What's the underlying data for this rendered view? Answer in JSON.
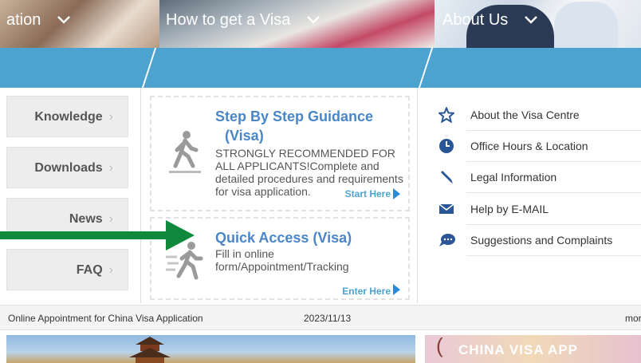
{
  "nav": {
    "left_partial": "ation",
    "middle": "How to get a Visa",
    "right": "About Us"
  },
  "left_menu": [
    {
      "label": "Knowledge"
    },
    {
      "label": "Downloads"
    },
    {
      "label": "News"
    },
    {
      "label": "FAQ"
    }
  ],
  "cards": {
    "step": {
      "title": "Step By Step Guidance",
      "title2": "(Visa)",
      "desc": "STRONGLY RECOMMENDED FOR ALL APPLICANTS!Complete and detailed procedures and requirements for visa application.",
      "link": "Start Here"
    },
    "quick": {
      "title": "Quick Access (Visa)",
      "desc": "Fill in online form/Appointment/Tracking",
      "link": "Enter Here"
    }
  },
  "about_links": [
    {
      "label": "About the Visa Centre",
      "icon": "star-icon"
    },
    {
      "label": "Office Hours & Location",
      "icon": "clock-icon"
    },
    {
      "label": "Legal Information",
      "icon": "pen-icon"
    },
    {
      "label": "Help by E-MAIL",
      "icon": "envelope-icon"
    },
    {
      "label": "Suggestions and Complaints",
      "icon": "chat-bubble-icon"
    }
  ],
  "ticker": {
    "text": "Online Appointment for China Visa Application",
    "date": "2023/11/13",
    "more": "mor"
  },
  "bottom_banner": {
    "app_label": "CHINA VISA APP"
  },
  "colors": {
    "nav_bg": "#4ca3cf",
    "title_blue": "#4a86c7",
    "arrow_green": "#0f8a3c"
  }
}
